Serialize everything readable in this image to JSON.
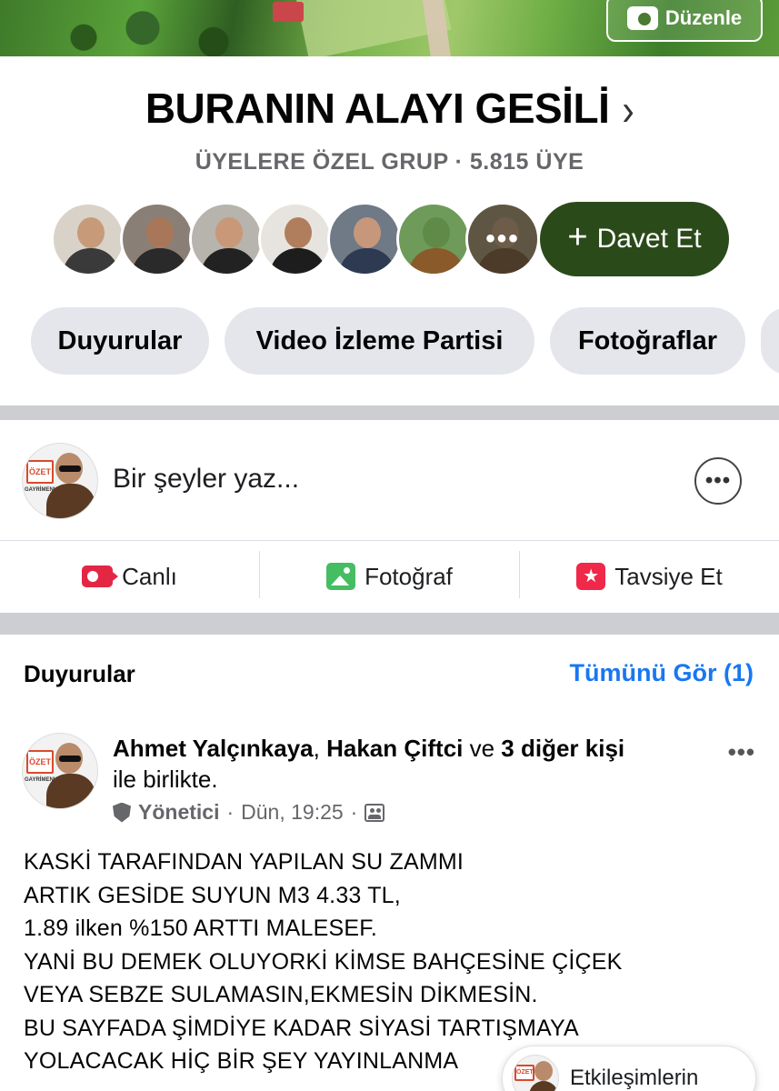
{
  "cover": {
    "edit_label": "Düzenle"
  },
  "group": {
    "name": "BURANIN ALAYI GESİLİ",
    "meta": "ÜYELERE ÖZEL GRUP · 5.815 ÜYE",
    "invite_label": "Davet Et",
    "more_members": "•••"
  },
  "chips": [
    "Duyurular",
    "Video İzleme Partisi",
    "Fotoğraflar"
  ],
  "composer": {
    "placeholder": "Bir şeyler yaz...",
    "more": "•••",
    "actions": [
      {
        "label": "Canlı",
        "icon": "live-video-icon",
        "color": "#e42645"
      },
      {
        "label": "Fotoğraf",
        "icon": "photo-icon",
        "color": "#45bd62"
      },
      {
        "label": "Tavsiye Et",
        "icon": "recommend-icon",
        "color": "#f02849"
      }
    ]
  },
  "announcements": {
    "title": "Duyurular",
    "see_all": "Tümünü Gör (1)",
    "post": {
      "author1": "Ahmet Yalçınkaya",
      "sep": ", ",
      "author2": "Hakan Çiftci",
      "and": " ve ",
      "others": "3 diğer kişi",
      "with": "ile birlikte.",
      "role": "Yönetici",
      "dot1": "·",
      "time": "Dün, 19:25",
      "dot2": "·",
      "more": "•••",
      "body": [
        "KASKİ TARAFINDAN YAPILAN SU ZAMMI",
        "ARTIK GESİDE SUYUN M3 4.33 TL,",
        "1.89 ilken %150 ARTTI MALESEF.",
        "YANİ BU DEMEK OLUYORKİ KİMSE BAHÇESİNE  ÇİÇEK",
        "VEYA SEBZE SULAMASIN,EKMESİN  DİKMESİN.",
        "BU SAYFADA ŞİMDİYE KADAR SİYASİ TARTIŞMAYA",
        "YOLACACAK HİÇ BİR ŞEY YAYINLANMA"
      ]
    },
    "engagement_label": "Etkileşimlerin"
  },
  "colors": {
    "accent": "#1877f2",
    "invite_bg": "#2b4a1a",
    "chip_bg": "#e4e6eb",
    "secondary_text": "#65676b"
  }
}
